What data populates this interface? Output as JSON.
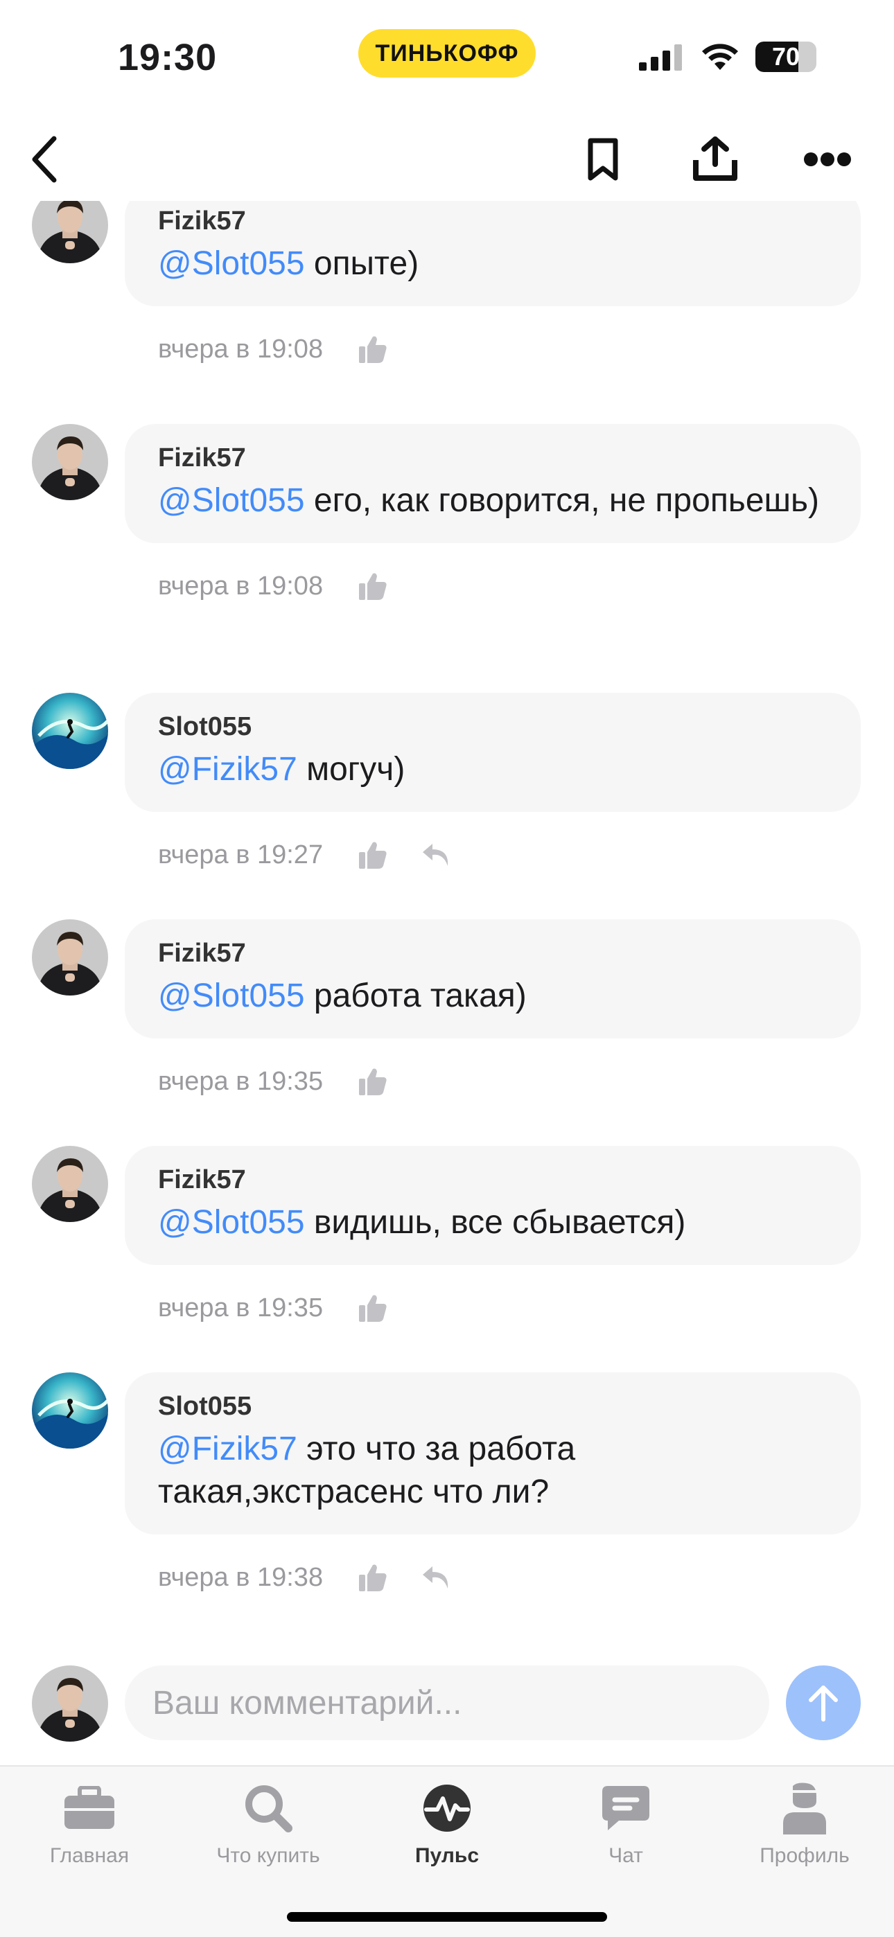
{
  "status_bar": {
    "time": "19:30",
    "brand": "ТИНЬКОФФ",
    "battery": "70",
    "battery_level": 0.7
  },
  "comments": [
    {
      "author": "Fizik57",
      "mention": "@Slot055",
      "text": " опыте)",
      "time": "вчера в 19:08",
      "avatar": "man-avatar",
      "reply": false
    },
    {
      "author": "Fizik57",
      "mention": "@Slot055",
      "text": " его, как говорится, не пропьешь)",
      "time": "вчера в 19:08",
      "avatar": "man-avatar",
      "reply": false
    },
    {
      "author": "Slot055",
      "mention": "@Fizik57",
      "text": " могуч)",
      "time": "вчера в 19:27",
      "avatar": "wave-avatar",
      "reply": true
    },
    {
      "author": "Fizik57",
      "mention": "@Slot055",
      "text": " работа такая)",
      "time": "вчера в 19:35",
      "avatar": "man-avatar",
      "reply": false
    },
    {
      "author": "Fizik57",
      "mention": "@Slot055",
      "text": " видишь, все сбывается)",
      "time": "вчера в 19:35",
      "avatar": "man-avatar",
      "reply": false
    },
    {
      "author": "Slot055",
      "mention": "@Fizik57",
      "text": " это что за работа такая,экстрасенс что ли?",
      "time": "вчера в 19:38",
      "avatar": "wave-avatar",
      "reply": true
    }
  ],
  "composer": {
    "placeholder": "Ваш комментарий..."
  },
  "tabs": [
    {
      "label": "Главная",
      "icon": "briefcase-icon",
      "active": false
    },
    {
      "label": "Что купить",
      "icon": "search-icon",
      "active": false
    },
    {
      "label": "Пульс",
      "icon": "pulse-icon",
      "active": true
    },
    {
      "label": "Чат",
      "icon": "chat-icon",
      "active": false
    },
    {
      "label": "Профиль",
      "icon": "profile-icon",
      "active": false
    }
  ],
  "colors": {
    "accent": "#428bf9",
    "brand": "#ffdd2d",
    "bubble": "#f6f6f7",
    "send": "#9dc1fb"
  }
}
